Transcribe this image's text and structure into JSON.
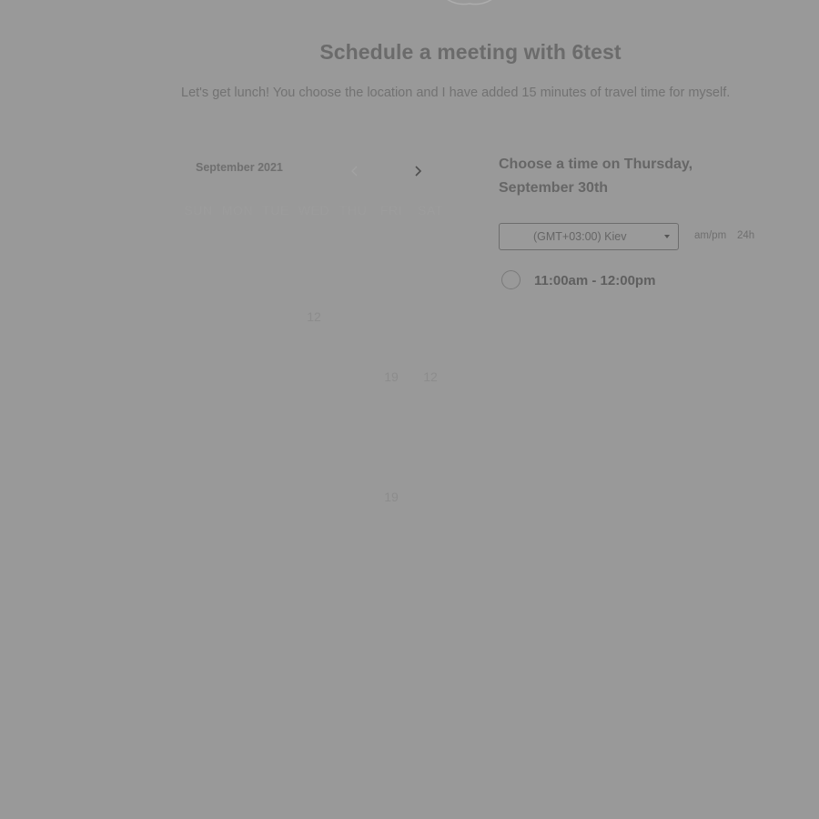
{
  "page": {
    "title": "Schedule a meeting with 6test",
    "subtitle": "Let's get lunch! You choose the location and I have added 15 minutes of travel time for myself."
  },
  "calendar": {
    "month_label": "September 2021",
    "prev_icon": "chevron-left-icon",
    "next_icon": "chevron-right-icon",
    "weekdays": [
      "SUN",
      "MON",
      "TUE",
      "WED",
      "THU",
      "FRI",
      "SAT"
    ],
    "visible_days": [
      {
        "label": "12",
        "row": 1,
        "col": 3
      },
      {
        "label": "19",
        "row": 2,
        "col": 5
      },
      {
        "label": "12",
        "row": 2,
        "col": 6
      },
      {
        "label": "19",
        "row": 4,
        "col": 5
      }
    ]
  },
  "time_picker": {
    "heading": "Choose a time on Thursday, September 30th",
    "timezone": {
      "value": "(GMT+03:00) Kiev",
      "icon": "dropdown-caret-icon"
    },
    "format_options": [
      "am/pm",
      "24h"
    ],
    "slots": [
      {
        "label": "11:00am - 12:00pm"
      }
    ]
  },
  "colors": {
    "overlay": "#999999",
    "heading_text": "#6b6b6b"
  }
}
